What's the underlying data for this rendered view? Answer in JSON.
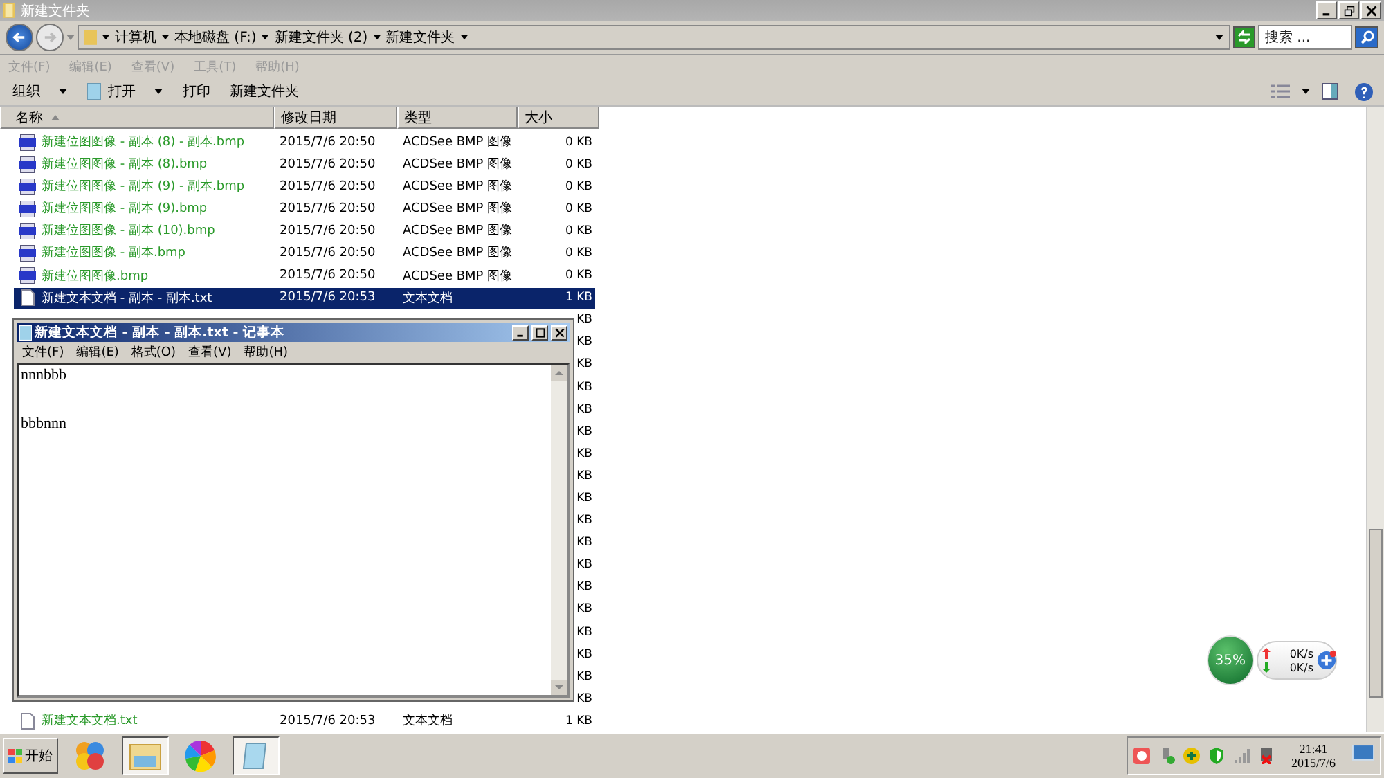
{
  "window": {
    "title": "新建文件夹"
  },
  "address": {
    "path": [
      "计算机",
      "本地磁盘 (F:)",
      "新建文件夹 (2)",
      "新建文件夹"
    ]
  },
  "search": {
    "placeholder": "搜索 ..."
  },
  "menu": [
    "文件(F)",
    "编辑(E)",
    "查看(V)",
    "工具(T)",
    "帮助(H)"
  ],
  "toolbar": [
    {
      "label": "组织",
      "kind": "dropdown"
    },
    {
      "label": "打开",
      "kind": "split"
    },
    {
      "label": "打印",
      "kind": "plain"
    },
    {
      "label": "新建文件夹",
      "kind": "plain"
    }
  ],
  "columns": [
    {
      "label": "名称",
      "sorted": true
    },
    {
      "label": "修改日期",
      "sorted": false
    },
    {
      "label": "类型",
      "sorted": false
    },
    {
      "label": "大小",
      "sorted": false
    }
  ],
  "rows": [
    {
      "kind": "bmp",
      "name": "新建位图图像 - 副本 (8) - 副本.bmp",
      "date": "2015/7/6 20:50",
      "type": "ACDSee BMP 图像",
      "size": "0 KB",
      "selected": false
    },
    {
      "kind": "bmp",
      "name": "新建位图图像 - 副本 (8).bmp",
      "date": "2015/7/6 20:50",
      "type": "ACDSee BMP 图像",
      "size": "0 KB",
      "selected": false
    },
    {
      "kind": "bmp",
      "name": "新建位图图像 - 副本 (9) - 副本.bmp",
      "date": "2015/7/6 20:50",
      "type": "ACDSee BMP 图像",
      "size": "0 KB",
      "selected": false
    },
    {
      "kind": "bmp",
      "name": "新建位图图像 - 副本 (9).bmp",
      "date": "2015/7/6 20:50",
      "type": "ACDSee BMP 图像",
      "size": "0 KB",
      "selected": false
    },
    {
      "kind": "bmp",
      "name": "新建位图图像 - 副本 (10).bmp",
      "date": "2015/7/6 20:50",
      "type": "ACDSee BMP 图像",
      "size": "0 KB",
      "selected": false
    },
    {
      "kind": "bmp",
      "name": "新建位图图像 - 副本.bmp",
      "date": "2015/7/6 20:50",
      "type": "ACDSee BMP 图像",
      "size": "0 KB",
      "selected": false
    },
    {
      "kind": "bmp",
      "name": "新建位图图像.bmp",
      "date": "2015/7/6 20:50",
      "type": "ACDSee BMP 图像",
      "size": "0 KB",
      "selected": false
    },
    {
      "kind": "txt",
      "name": "新建文本文档 - 副本 - 副本.txt",
      "date": "2015/7/6 20:53",
      "type": "文本文档",
      "size": "1 KB",
      "selected": true
    },
    {
      "kind": "hidden",
      "size": "KB"
    },
    {
      "kind": "hidden",
      "size": "KB"
    },
    {
      "kind": "hidden",
      "size": "KB"
    },
    {
      "kind": "hidden",
      "size": "KB"
    },
    {
      "kind": "hidden",
      "size": "KB"
    },
    {
      "kind": "hidden",
      "size": "KB"
    },
    {
      "kind": "hidden",
      "size": "KB"
    },
    {
      "kind": "hidden",
      "size": "KB"
    },
    {
      "kind": "hidden",
      "size": "KB"
    },
    {
      "kind": "hidden",
      "size": "KB"
    },
    {
      "kind": "hidden",
      "size": "KB"
    },
    {
      "kind": "hidden",
      "size": "KB"
    },
    {
      "kind": "hidden",
      "size": "KB"
    },
    {
      "kind": "hidden",
      "size": "KB"
    },
    {
      "kind": "hidden",
      "size": "KB"
    },
    {
      "kind": "hidden",
      "size": "KB"
    },
    {
      "kind": "hidden",
      "size": "KB"
    },
    {
      "kind": "hidden",
      "size": "KB"
    },
    {
      "kind": "txt",
      "name": "新建文本文档.txt",
      "date": "2015/7/6 20:53",
      "type": "文本文档",
      "size": "1 KB",
      "selected": false
    }
  ],
  "notepad": {
    "title": "新建文本文档 - 副本 - 副本.txt - 记事本",
    "menu": [
      "文件(F)",
      "编辑(E)",
      "格式(O)",
      "查看(V)",
      "帮助(H)"
    ],
    "text": "nnnbbb\n\n\nbbbnnn"
  },
  "speed_widget": {
    "percent": "35%",
    "upload": "0K/s",
    "download": "0K/s"
  },
  "taskbar": {
    "start": "开始",
    "apps": [
      {
        "kind": "balls",
        "active": false
      },
      {
        "kind": "folder",
        "active": true
      },
      {
        "kind": "pinwheel",
        "active": false
      },
      {
        "kind": "notepad",
        "active": true
      }
    ],
    "time": "21:41",
    "date": "2015/7/6"
  }
}
